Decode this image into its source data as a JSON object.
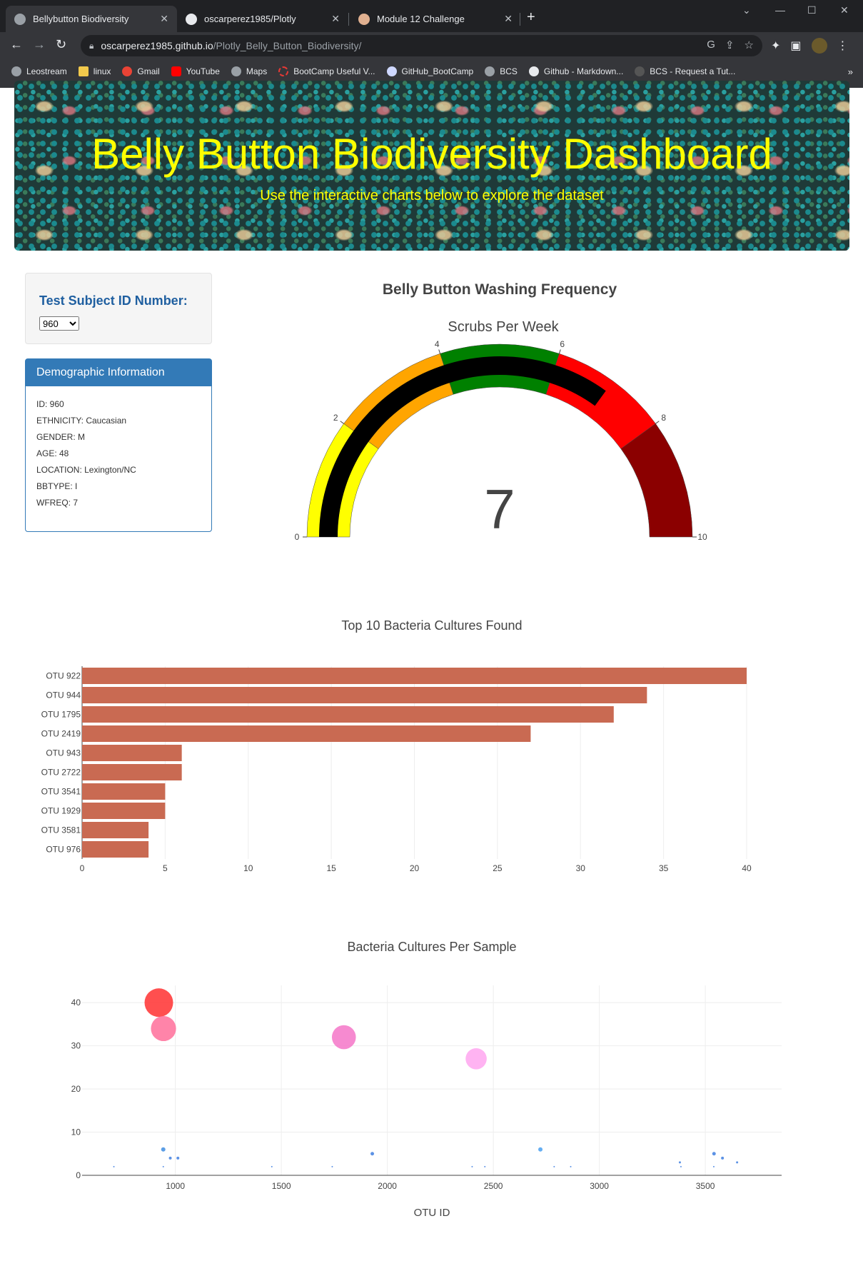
{
  "browser": {
    "tabs": [
      {
        "label": "Bellybutton Biodiversity",
        "active": true,
        "icon": "globe-icon"
      },
      {
        "label": "oscarperez1985/Plotly",
        "active": false,
        "icon": "github-icon"
      },
      {
        "label": "Module 12 Challenge",
        "active": false,
        "icon": "bootcamp-icon"
      }
    ],
    "url_host": "oscarperez1985.github.io",
    "url_path": "/Plotly_Belly_Button_Biodiversity/",
    "bookmarks": [
      {
        "label": "Leostream",
        "icon": "globe-icon"
      },
      {
        "label": "linux",
        "icon": "folder-icon"
      },
      {
        "label": "Gmail",
        "icon": "google-icon"
      },
      {
        "label": "YouTube",
        "icon": "youtube-icon"
      },
      {
        "label": "Maps",
        "icon": "globe-icon"
      },
      {
        "label": "BootCamp Useful V...",
        "icon": "circle-icon"
      },
      {
        "label": "GitHub_BootCamp",
        "icon": "puzzle-icon"
      },
      {
        "label": "BCS",
        "icon": "globe-icon"
      },
      {
        "label": "Github - Markdown...",
        "icon": "github-icon"
      },
      {
        "label": "BCS - Request a Tut...",
        "icon": "phone-icon"
      }
    ]
  },
  "header": {
    "title": "Belly Button Biodiversity Dashboard",
    "subtitle": "Use the interactive charts below to explore the dataset"
  },
  "selector": {
    "label": "Test Subject ID Number:",
    "selected": "960"
  },
  "demographics": {
    "heading": "Demographic Information",
    "rows": [
      "ID: 960",
      "ETHNICITY: Caucasian",
      "GENDER: M",
      "AGE: 48",
      "LOCATION: Lexington/NC",
      "BBTYPE: I",
      "WFREQ: 7"
    ]
  },
  "chart_data": [
    {
      "type": "gauge",
      "title": "Belly Button Washing Frequency",
      "subtitle": "Scrubs Per Week",
      "value": 7,
      "range": [
        0,
        10
      ],
      "ticks": [
        0,
        2,
        4,
        6,
        8,
        10
      ],
      "steps": [
        {
          "range": [
            0,
            2
          ],
          "color": "#ffff00"
        },
        {
          "range": [
            2,
            4
          ],
          "color": "#ffa500"
        },
        {
          "range": [
            4,
            6
          ],
          "color": "#008000"
        },
        {
          "range": [
            6,
            8
          ],
          "color": "#ff0000"
        },
        {
          "range": [
            8,
            10
          ],
          "color": "#8b0000"
        }
      ],
      "bar_color": "#000000"
    },
    {
      "type": "bar",
      "orientation": "horizontal",
      "title": "Top 10 Bacteria Cultures Found",
      "categories": [
        "OTU 922",
        "OTU 944",
        "OTU 1795",
        "OTU 2419",
        "OTU 943",
        "OTU 2722",
        "OTU 3541",
        "OTU 1929",
        "OTU 3581",
        "OTU 976"
      ],
      "values": [
        40,
        34,
        32,
        27,
        6,
        6,
        5,
        5,
        4,
        4
      ],
      "xlim": [
        0,
        40
      ],
      "xticks": [
        0,
        5,
        10,
        15,
        20,
        25,
        30,
        35,
        40
      ],
      "color": "#c96a52",
      "grid": true
    },
    {
      "type": "scatter",
      "title": "Bacteria Cultures Per Sample",
      "xlabel": "OTU ID",
      "xticks": [
        1000,
        1500,
        2000,
        2500,
        3000,
        3500
      ],
      "yticks": [
        0,
        10,
        20,
        30,
        40
      ],
      "xlim": [
        560,
        3860
      ],
      "ylim": [
        0,
        44
      ],
      "grid": true,
      "points": [
        {
          "x": 922,
          "y": 40,
          "color": "#ff3030"
        },
        {
          "x": 944,
          "y": 34,
          "color": "#ff6f9a"
        },
        {
          "x": 1795,
          "y": 32,
          "color": "#f476c8"
        },
        {
          "x": 2419,
          "y": 27,
          "color": "#ffa6f0"
        },
        {
          "x": 943,
          "y": 6,
          "color": "#3f8de0"
        },
        {
          "x": 2722,
          "y": 6,
          "color": "#4aa0f0"
        },
        {
          "x": 3541,
          "y": 5,
          "color": "#3f7fe0"
        },
        {
          "x": 1929,
          "y": 5,
          "color": "#3f7fe0"
        },
        {
          "x": 3581,
          "y": 4,
          "color": "#3f7fe0"
        },
        {
          "x": 976,
          "y": 4,
          "color": "#3f7fe0"
        },
        {
          "x": 1012,
          "y": 4,
          "color": "#3f7fe0"
        },
        {
          "x": 3650,
          "y": 3,
          "color": "#3f7fe0"
        },
        {
          "x": 3380,
          "y": 3,
          "color": "#3f7fe0"
        },
        {
          "x": 3385,
          "y": 2,
          "color": "#3f7fe0"
        },
        {
          "x": 3540,
          "y": 2,
          "color": "#3f7fe0"
        },
        {
          "x": 2787,
          "y": 2,
          "color": "#3f7fe0"
        },
        {
          "x": 2865,
          "y": 2,
          "color": "#3f7fe0"
        },
        {
          "x": 2400,
          "y": 2,
          "color": "#3f7fe0"
        },
        {
          "x": 2460,
          "y": 2,
          "color": "#3f7fe0"
        },
        {
          "x": 1740,
          "y": 2,
          "color": "#3f7fe0"
        },
        {
          "x": 1455,
          "y": 2,
          "color": "#3f7fe0"
        },
        {
          "x": 943,
          "y": 2,
          "color": "#3f7fe0"
        },
        {
          "x": 710,
          "y": 2,
          "color": "#3f7fe0"
        }
      ]
    }
  ],
  "colors": {
    "header_text": "#ffff00",
    "panel_primary": "#337ab7",
    "label_blue": "#1f5fa0"
  }
}
